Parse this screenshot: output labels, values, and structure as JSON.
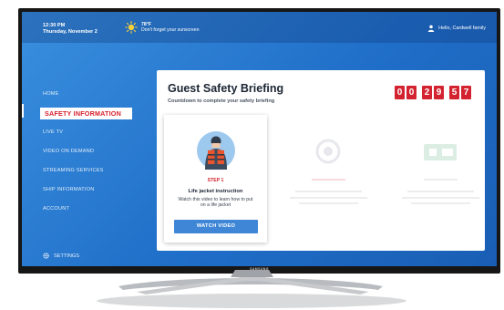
{
  "clock": {
    "time": "12:30 PM",
    "date": "Thursday, November 2"
  },
  "weather": {
    "temp": "78°F",
    "message": "Don't forget your sunscreen"
  },
  "greeting": "Hello, Cardwell family",
  "sidebar": {
    "items": [
      {
        "label": "HOME",
        "active": false
      },
      {
        "label": "SAFETY INFORMATION",
        "active": true
      },
      {
        "label": "LIVE TV",
        "active": false
      },
      {
        "label": "VIDEO ON DEMAND",
        "active": false
      },
      {
        "label": "STREAMING SERVICES",
        "active": false
      },
      {
        "label": "SHIP INFORMATION",
        "active": false
      },
      {
        "label": "ACCOUNT",
        "active": false
      }
    ],
    "settings": "SETTINGS"
  },
  "briefing": {
    "title": "Guest Safety Briefing",
    "subtitle": "Countdown to complete your safety briefing",
    "countdown": [
      "0",
      "0",
      "2",
      "9",
      "5",
      "7"
    ]
  },
  "step1": {
    "step": "STEP 1",
    "title": "Life jacket instruction",
    "description": "Watch this video to learn how to put on a life jacket",
    "button": "WATCH VIDEO"
  },
  "colors": {
    "accent": "#d32330",
    "screen_blue": "#2a7fd6",
    "button_blue": "#3f86d6"
  },
  "brand": "SAMSUNG"
}
